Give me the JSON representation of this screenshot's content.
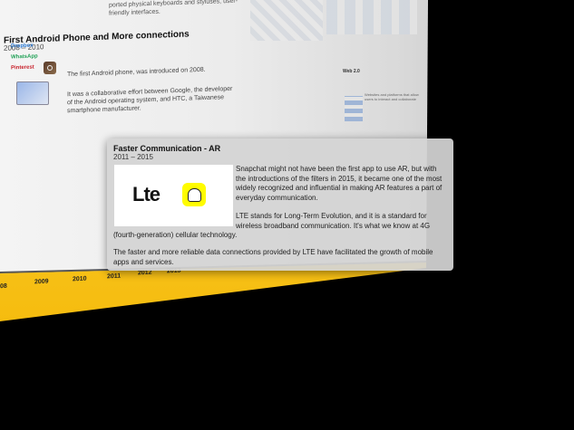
{
  "background": {
    "top_snippet": "ported physical keyboards and styluses, user-friendly interfaces.",
    "section_title": "First Android Phone and More connections",
    "section_years": "2008 – 2010",
    "para_1": "The first Android phone, was introduced on 2008.",
    "para_2": "It was a collaborative effort between Google, the developer of the Android operating system, and HTC, a Taiwanese smartphone manufacturer.",
    "app_logos": [
      "Dropbox",
      "WhatsApp",
      "Pinterest"
    ],
    "side_mini_title": "Web 2.0",
    "side_mini_text": "Websites and platforms that allow users to interact and collaborate"
  },
  "timeline": {
    "years": [
      "08",
      "2009",
      "2010",
      "2011",
      "2012",
      "2013"
    ],
    "accent_color": "#f5bd0b"
  },
  "card": {
    "title": "Faster Communication - AR",
    "years": "2011 – 2015",
    "image_logo_text": "Lte",
    "image_icons": [
      "lte-logo",
      "snapchat-icon"
    ],
    "paragraph_1": "Snapchat might not have been the first app to use AR, but with the introductions of the filters in 2015, it became one of the most widely recognized and influential in making AR features a part of everyday communication.",
    "paragraph_2": "LTE stands for Long-Term Evolution, and it is a standard for wireless broadband communication. It's what we know at 4G",
    "paragraph_2_cont": "(fourth-generation) cellular technology.",
    "paragraph_3": "The faster and more reliable data connections provided by LTE have facilitated the growth of mobile apps and services."
  }
}
